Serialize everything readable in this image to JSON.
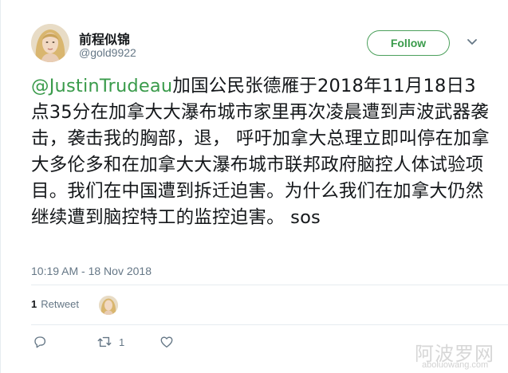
{
  "user": {
    "display_name": "前程似锦",
    "handle": "@gold9922"
  },
  "follow_label": "Follow",
  "tweet": {
    "mention": "@JustinTrudeau",
    "body": "加国公民张德雁于2018年11月18日3点35分在加拿大大瀑布城市家里再次凌晨遭到声波武器袭击，袭击我的胸部，退， 呼吁加拿大总理立即叫停在加拿大多伦多和在加拿大大瀑布城市联邦政府脑控人体试验项目。我们在中国遭到拆迁迫害。为什么我们在加拿大仍然继续遭到脑控特工的监控迫害。  sos",
    "timestamp": "10:19 AM - 18 Nov 2018"
  },
  "stats": {
    "retweet_count": "1",
    "retweet_label": "Retweet"
  },
  "actions": {
    "reply_count": "",
    "retweet_count": "1",
    "like_count": ""
  },
  "watermark": {
    "cn": "阿波罗网",
    "url": "aboluowang.com"
  },
  "colors": {
    "accent": "#3a9b4b",
    "muted": "#657786",
    "text": "#14171a",
    "divider": "#e6ecf0"
  }
}
